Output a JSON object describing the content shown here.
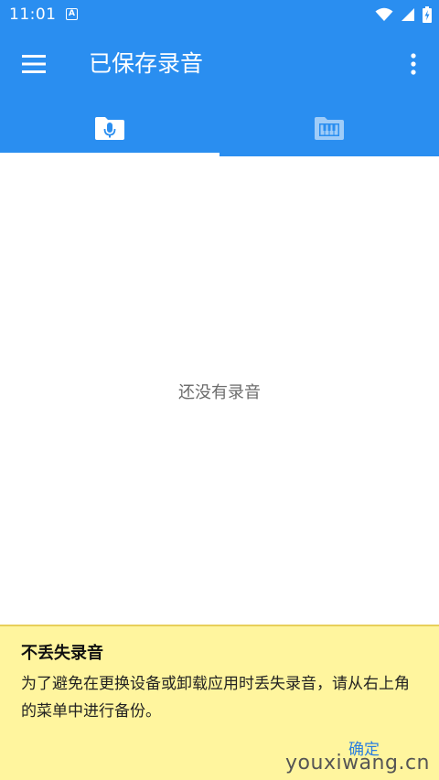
{
  "status_bar": {
    "time": "11:01",
    "a_icon": "A"
  },
  "app_bar": {
    "title": "已保存录音",
    "menu_icon": "hamburger-menu-icon",
    "more_icon": "more-vertical-icon",
    "color": "#2a8ef0"
  },
  "tabs": [
    {
      "icon": "microphone-folder-icon",
      "selected": true
    },
    {
      "icon": "piano-folder-icon",
      "selected": false
    }
  ],
  "content": {
    "empty_message": "还没有录音"
  },
  "notice": {
    "title": "不丢失录音",
    "body": "为了避免在更换设备或卸载应用时丢失录音，请从右上角的菜单中进行备份。",
    "ok_label": "确定",
    "background": "#fff59e"
  },
  "watermark": "youxiwang.cn"
}
